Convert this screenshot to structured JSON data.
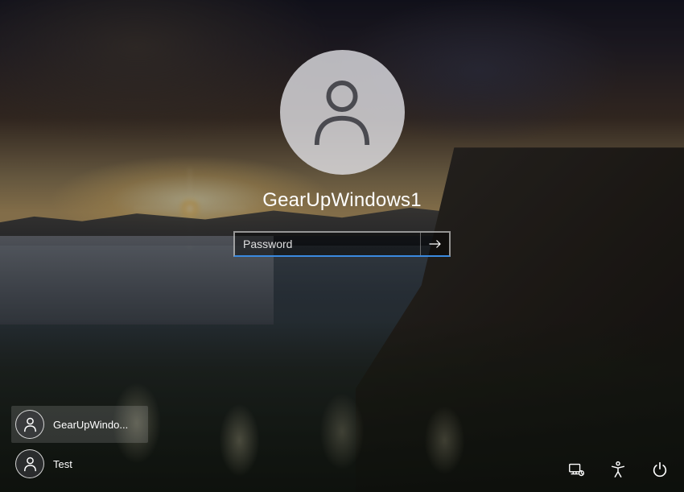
{
  "login": {
    "username": "GearUpWindows1",
    "password_placeholder": "Password",
    "password_value": ""
  },
  "users": [
    {
      "label": "GearUpWindo...",
      "selected": true
    },
    {
      "label": "Test",
      "selected": false
    }
  ],
  "icons": {
    "network": "network-icon",
    "accessibility": "accessibility-icon",
    "power": "power-icon"
  }
}
